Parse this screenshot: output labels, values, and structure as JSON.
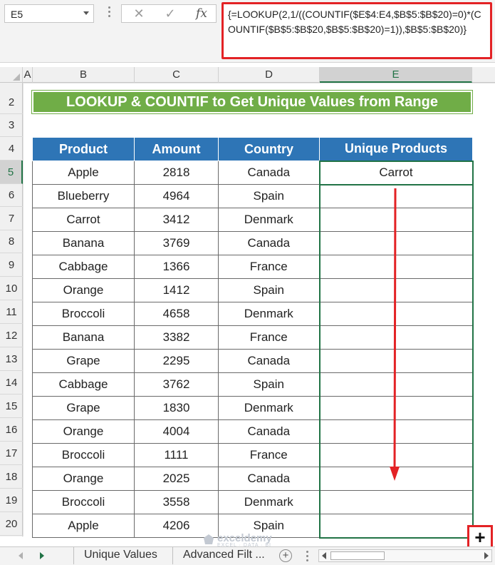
{
  "formula_bar": {
    "name_box": "E5",
    "cancel_icon": "x-icon",
    "enter_icon": "check-icon",
    "fx_label": "fx",
    "formula": "{=LOOKUP(2,1/((COUNTIF($E$4:E4,$B$5:$B$20)=0)*(COUNTIF($B$5:$B$20,$B$5:$B$20)=1)),$B$5:$B$20)}"
  },
  "columns": [
    "A",
    "B",
    "C",
    "D",
    "E"
  ],
  "rows": [
    "2",
    "3",
    "4",
    "5",
    "6",
    "7",
    "8",
    "9",
    "10",
    "11",
    "12",
    "13",
    "14",
    "15",
    "16",
    "17",
    "18",
    "19",
    "20"
  ],
  "sheet": {
    "title": "LOOKUP & COUNTIF to Get Unique Values from Range",
    "headers": [
      "Product",
      "Amount",
      "Country",
      "Unique Products"
    ],
    "data": [
      [
        "Apple",
        "2818",
        "Canada",
        "Carrot"
      ],
      [
        "Blueberry",
        "4964",
        "Spain",
        ""
      ],
      [
        "Carrot",
        "3412",
        "Denmark",
        ""
      ],
      [
        "Banana",
        "3769",
        "Canada",
        ""
      ],
      [
        "Cabbage",
        "1366",
        "France",
        ""
      ],
      [
        "Orange",
        "1412",
        "Spain",
        ""
      ],
      [
        "Broccoli",
        "4658",
        "Denmark",
        ""
      ],
      [
        "Banana",
        "3382",
        "France",
        ""
      ],
      [
        "Grape",
        "2295",
        "Canada",
        ""
      ],
      [
        "Cabbage",
        "3762",
        "Spain",
        ""
      ],
      [
        "Grape",
        "1830",
        "Denmark",
        ""
      ],
      [
        "Orange",
        "4004",
        "Canada",
        ""
      ],
      [
        "Broccoli",
        "1111",
        "France",
        ""
      ],
      [
        "Orange",
        "2025",
        "Canada",
        ""
      ],
      [
        "Broccoli",
        "3558",
        "Denmark",
        ""
      ],
      [
        "Apple",
        "4206",
        "Spain",
        ""
      ]
    ]
  },
  "fill_handle_label": "+",
  "watermark": {
    "name": "exceldemy",
    "sub": "EXCEL · DATA · BI"
  },
  "tabs": {
    "items": [
      "Unique Values",
      "Advanced Filt ..."
    ],
    "add_label": "+"
  },
  "colors": {
    "title_green": "#70ad47",
    "header_blue": "#2e75b6",
    "highlight_red": "#e32225",
    "selection_green": "#217346"
  }
}
